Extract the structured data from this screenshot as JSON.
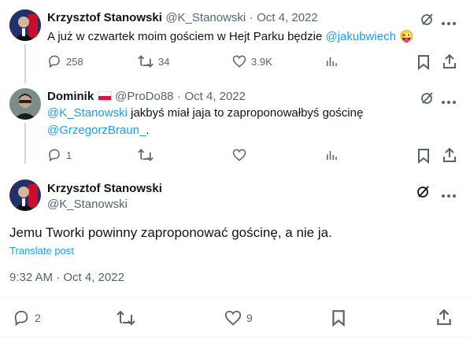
{
  "tweet1": {
    "display_name": "Krzysztof Stanowski",
    "handle": "@K_Stanowski",
    "separator": "·",
    "date": "Oct 4, 2022",
    "text": "A już w czwartek moim gościem w Hejt Parku będzie",
    "mention": "@jakubwiech",
    "emoji": "😜",
    "replies": "258",
    "retweets": "34",
    "likes": "3.9K"
  },
  "tweet2": {
    "display_name": "Dominik",
    "handle": "@ProDo88",
    "separator": "·",
    "date": "Oct 4, 2022",
    "mention1": "@K_Stanowski",
    "text": "jakbyś miał jaja to zaproponowałbyś gościnę",
    "mention2": "@GrzegorzBraun_",
    "text_end": ".",
    "replies": "1"
  },
  "main_tweet": {
    "display_name": "Krzysztof Stanowski",
    "handle": "@K_Stanowski",
    "text": "Jemu Tworki powinny zaproponować gościnę, a nie ja.",
    "translate_label": "Translate post",
    "timestamp": "9:32 AM · Oct 4, 2022",
    "replies": "2",
    "likes": "9"
  },
  "colors": {
    "accent": "#1d9bf0",
    "muted": "#536471",
    "text": "#0f1419"
  }
}
